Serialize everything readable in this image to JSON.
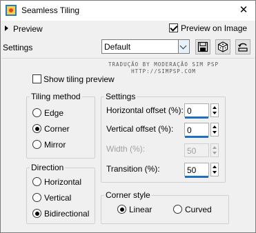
{
  "window": {
    "title": "Seamless Tiling",
    "close_glyph": "✕"
  },
  "header": {
    "preview_toggle_label": "Preview",
    "preview_on_image_label": "Preview on Image",
    "preview_on_image_checked": true,
    "settings_label": "Settings",
    "preset_value": "Default"
  },
  "watermark": {
    "line1": "TRADUÇÃO BY MODERAÇÃO SIM PSP",
    "line2": "HTTP://SIMPSP.COM"
  },
  "options": {
    "show_tiling_preview_label": "Show tiling preview",
    "show_tiling_preview_checked": false
  },
  "tiling_method": {
    "title": "Tiling method",
    "options": [
      {
        "label": "Edge",
        "checked": false
      },
      {
        "label": "Corner",
        "checked": true
      },
      {
        "label": "Mirror",
        "checked": false
      }
    ]
  },
  "direction": {
    "title": "Direction",
    "options": [
      {
        "label": "Horizontal",
        "checked": false
      },
      {
        "label": "Vertical",
        "checked": false
      },
      {
        "label": "Bidirectional",
        "checked": true
      }
    ]
  },
  "settings": {
    "title": "Settings",
    "horizontal_offset": {
      "label": "Horizontal offset (%):",
      "value": "0"
    },
    "vertical_offset": {
      "label": "Vertical offset (%):",
      "value": "0"
    },
    "width": {
      "label": "Width (%):",
      "value": "50",
      "disabled": true
    },
    "transition": {
      "label": "Transition (%):",
      "value": "50"
    }
  },
  "corner_style": {
    "title": "Corner style",
    "options": [
      {
        "label": "Linear",
        "checked": true
      },
      {
        "label": "Curved",
        "checked": false
      }
    ]
  },
  "colors": {
    "accent": "#1f6fbf",
    "window_bg": "#f0f0f0",
    "titlebar_bg": "#ffffff"
  }
}
